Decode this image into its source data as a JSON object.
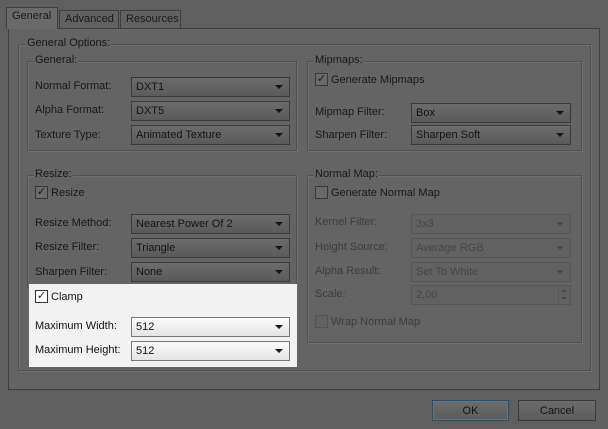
{
  "tabs": [
    "General",
    "Advanced",
    "Resources"
  ],
  "general_options": {
    "legend": "General Options:",
    "general": {
      "legend": "General:",
      "normal_format": {
        "label": "Normal Format:",
        "value": "DXT1"
      },
      "alpha_format": {
        "label": "Alpha Format:",
        "value": "DXT5"
      },
      "texture_type": {
        "label": "Texture Type:",
        "value": "Animated Texture"
      }
    },
    "mipmaps": {
      "legend": "Mipmaps:",
      "generate": {
        "label": "Generate Mipmaps",
        "checked": true
      },
      "filter": {
        "label": "Mipmap Filter:",
        "value": "Box"
      },
      "sharpen": {
        "label": "Sharpen Filter:",
        "value": "Sharpen Soft"
      }
    },
    "resize": {
      "legend": "Resize:",
      "resize": {
        "label": "Resize",
        "checked": true
      },
      "method": {
        "label": "Resize Method:",
        "value": "Nearest Power Of 2"
      },
      "filter": {
        "label": "Resize Filter:",
        "value": "Triangle"
      },
      "sharpen": {
        "label": "Sharpen Filter:",
        "value": "None"
      },
      "clamp": {
        "label": "Clamp",
        "checked": true
      },
      "max_width": {
        "label": "Maximum Width:",
        "value": "512"
      },
      "max_height": {
        "label": "Maximum Height:",
        "value": "512"
      }
    },
    "normal_map": {
      "legend": "Normal Map:",
      "generate": {
        "label": "Generate Normal Map",
        "checked": false
      },
      "kernel": {
        "label": "Kernel Filter:",
        "value": "3x3"
      },
      "height_source": {
        "label": "Height Source:",
        "value": "Average RGB"
      },
      "alpha_result": {
        "label": "Alpha Result:",
        "value": "Set To White"
      },
      "scale": {
        "label": "Scale:",
        "value": "2,00"
      },
      "wrap": {
        "label": "Wrap Normal Map",
        "checked": false
      }
    }
  },
  "buttons": {
    "ok": "OK",
    "cancel": "Cancel"
  },
  "colors": {
    "dialog_dim": "#5f5f5f",
    "highlight_bg": "#f2f2f2",
    "default_button_border": "#2f4e63"
  },
  "icons": {
    "checked": "check-mark",
    "dropdown": "chevron-down-icon"
  }
}
